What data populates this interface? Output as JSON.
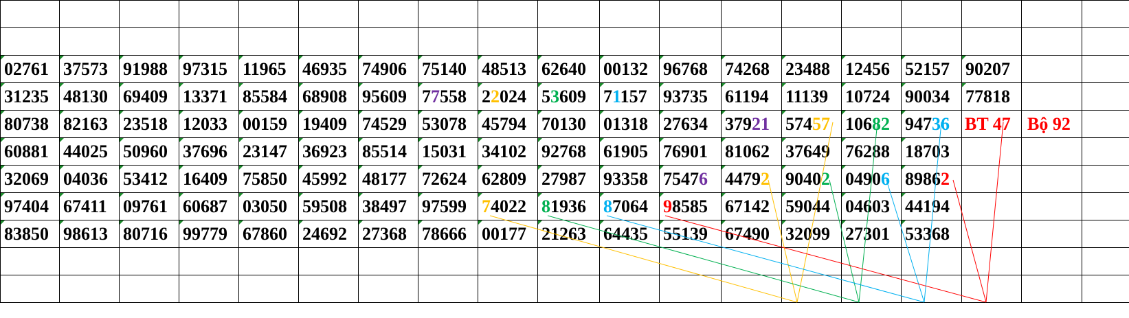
{
  "grid": {
    "rows": [
      [
        "02761",
        "37573",
        "91988",
        "97315",
        "11965",
        "46935",
        "74906",
        "75140",
        "48513",
        "62640",
        "00132",
        "96768",
        "74268",
        "23488",
        "12456",
        "52157",
        "90207"
      ],
      [
        "31235",
        "48130",
        "69409",
        "13371",
        "85584",
        "68908",
        "95609",
        "77558",
        "22024",
        "53609",
        "71157",
        "93735",
        "61194",
        "11139",
        "10724",
        "90034",
        "77818"
      ],
      [
        "80738",
        "82163",
        "23518",
        "12033",
        "00159",
        "19409",
        "74529",
        "53078",
        "45794",
        "70130",
        "01318",
        "27634",
        "37921",
        "57457",
        "10682",
        "94736"
      ],
      [
        "60881",
        "44025",
        "50960",
        "37696",
        "23147",
        "36923",
        "85514",
        "15031",
        "34102",
        "92768",
        "61905",
        "76901",
        "81062",
        "37649",
        "76288",
        "18703"
      ],
      [
        "32069",
        "04036",
        "53412",
        "16409",
        "75850",
        "45992",
        "48177",
        "72624",
        "62809",
        "27987",
        "93358",
        "75476",
        "44792",
        "90402",
        "04906",
        "89862"
      ],
      [
        "97404",
        "67411",
        "09761",
        "60687",
        "03050",
        "59508",
        "38497",
        "97599",
        "74022",
        "81936",
        "87064",
        "98585",
        "67142",
        "59044",
        "04603",
        "44194"
      ],
      [
        "83850",
        "98613",
        "80716",
        "99779",
        "67860",
        "24692",
        "27368",
        "78666",
        "00177",
        "21263",
        "64435",
        "55139",
        "67490",
        "32099",
        "27301",
        "53368"
      ]
    ],
    "labels": {
      "bt": "BT 47",
      "bo": "Bộ 92"
    }
  },
  "highlights": [
    {
      "row": 1,
      "col": 7,
      "pos": 1,
      "color": "#7030a0"
    },
    {
      "row": 1,
      "col": 8,
      "pos": 1,
      "color": "#ffc000"
    },
    {
      "row": 1,
      "col": 9,
      "pos": 1,
      "color": "#00b050"
    },
    {
      "row": 1,
      "col": 10,
      "pos": 1,
      "color": "#00b0f0"
    },
    {
      "row": 2,
      "col": 12,
      "pos": 3,
      "len": 2,
      "color": "#7030a0"
    },
    {
      "row": 2,
      "col": 13,
      "pos": 3,
      "len": 2,
      "color": "#ffc000"
    },
    {
      "row": 2,
      "col": 14,
      "pos": 3,
      "len": 2,
      "color": "#00b050"
    },
    {
      "row": 2,
      "col": 15,
      "pos": 3,
      "len": 2,
      "color": "#00b0f0"
    },
    {
      "row": 4,
      "col": 11,
      "pos": 4,
      "color": "#7030a0"
    },
    {
      "row": 4,
      "col": 12,
      "pos": 4,
      "color": "#ffc000"
    },
    {
      "row": 4,
      "col": 13,
      "pos": 4,
      "color": "#00b050"
    },
    {
      "row": 4,
      "col": 14,
      "pos": 4,
      "color": "#00b0f0"
    },
    {
      "row": 4,
      "col": 15,
      "pos": 4,
      "color": "#ff0000"
    },
    {
      "row": 5,
      "col": 8,
      "pos": 0,
      "color": "#ffc000"
    },
    {
      "row": 5,
      "col": 9,
      "pos": 0,
      "color": "#00b050"
    },
    {
      "row": 5,
      "col": 10,
      "pos": 0,
      "color": "#00b0f0"
    },
    {
      "row": 5,
      "col": 11,
      "pos": 0,
      "color": "#ff0000"
    }
  ],
  "line_colors": [
    "#ffc000",
    "#00b050",
    "#00b0f0",
    "#ff0000"
  ]
}
